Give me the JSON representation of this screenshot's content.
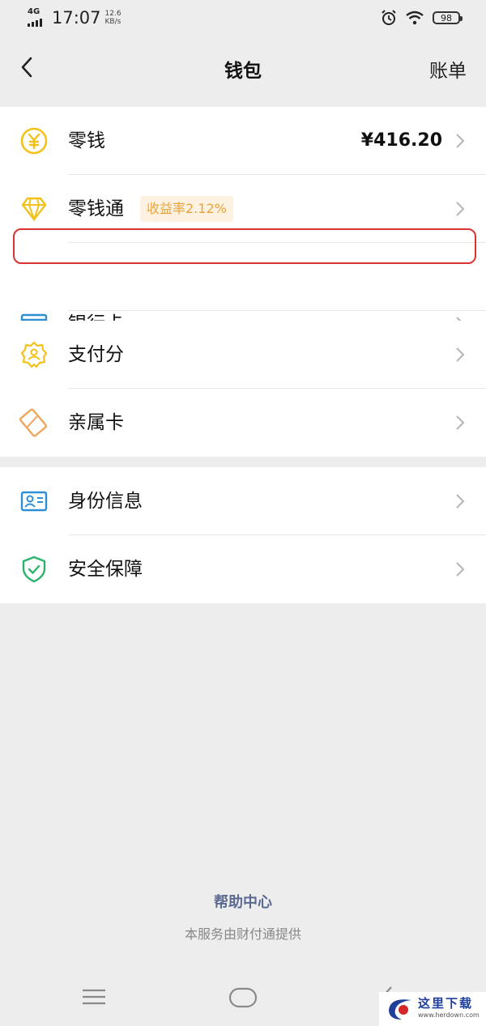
{
  "status_bar": {
    "network": "4G",
    "time": "17:07",
    "speed_value": "12.6",
    "speed_unit": "KB/s",
    "battery": "98"
  },
  "header": {
    "title": "钱包",
    "right_action": "账单"
  },
  "sections": {
    "balance": {
      "label": "零钱",
      "value": "¥416.20"
    },
    "fund": {
      "label": "零钱通",
      "badge": "收益率2.12%"
    },
    "bank": {
      "label": "银行卡"
    },
    "score": {
      "label": "支付分"
    },
    "family": {
      "label": "亲属卡"
    },
    "identity": {
      "label": "身份信息"
    },
    "security": {
      "label": "安全保障"
    }
  },
  "footer": {
    "help": "帮助中心",
    "provider": "本服务由财付通提供"
  },
  "watermark": {
    "brand": "这里下载",
    "url": "www.herdown.com"
  },
  "colors": {
    "highlight": "#d93333",
    "badge_text": "#e8a53c",
    "help_link": "#5b6a91",
    "yellow_icon": "#f2c21b",
    "bank_icon": "#2f8fd6",
    "green_icon": "#2bb36b",
    "orange_icon": "#f0a55c"
  },
  "icons": [
    "yen-coin-icon",
    "diamond-icon",
    "bank-card-icon",
    "badge-star-icon",
    "family-card-icon",
    "id-card-icon",
    "shield-check-icon",
    "back-chevron-icon",
    "chevron-right-icon",
    "menu-icon",
    "home-icon",
    "back-gesture-icon"
  ]
}
